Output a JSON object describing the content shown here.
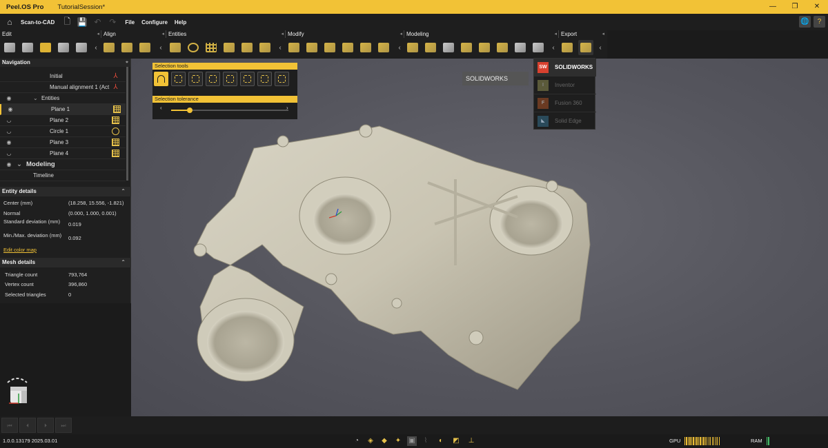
{
  "titlebar": {
    "app_name": "Peel.OS Pro",
    "session": "TutorialSession*",
    "minimize": "—",
    "restore": "❐",
    "close": "✕"
  },
  "menubar": {
    "mode": "Scan-to-CAD",
    "file": "File",
    "configure": "Configure",
    "help": "Help"
  },
  "toolbar_sections": {
    "edit": "Edit",
    "align": "Align",
    "entities": "Entities",
    "modify": "Modify",
    "modeling": "Modeling",
    "export": "Export"
  },
  "navigation": {
    "title": "Navigation",
    "rows": {
      "initial": "Initial",
      "manual": "Manual alignment 1 (Act",
      "entities": "Entities",
      "plane1": "Plane 1",
      "plane2": "Plane 2",
      "circle1": "Circle 1",
      "plane3": "Plane 3",
      "plane4": "Plane 4",
      "modeling": "Modeling",
      "timeline": "Timeline"
    }
  },
  "entity_details": {
    "title": "Entity details",
    "center_k": "Center (mm)",
    "center_v": "(18.258, 15.556, -1.821)",
    "normal_k": "Normal",
    "normal_v": "(0.000, 1.000, 0.001)",
    "std_k": "Standard deviation (mm)",
    "std_v": "0.019",
    "minmax_k": "Min./Max. deviation (mm)",
    "minmax_v": "0.092",
    "link": "Edit color map"
  },
  "mesh_details": {
    "title": "Mesh details",
    "tri_k": "Triangle count",
    "tri_v": "793,764",
    "vert_k": "Vertex count",
    "vert_v": "396,860",
    "sel_k": "Selected triangles",
    "sel_v": "0"
  },
  "selection_tools": {
    "title": "Selection tools",
    "tolerance_title": "Selection tolerance",
    "tolerance_value": 0.16
  },
  "export_menu": {
    "solidworks": "SOLIDWORKS",
    "inventor": "Inventor",
    "fusion": "Fusion 360",
    "solidedge": "Solid Edge"
  },
  "tooltip": {
    "text": "SOLIDWORKS"
  },
  "status": {
    "version": "1.0.0.13179 2025.03.01",
    "gpu": "GPU",
    "ram": "RAM"
  },
  "colors": {
    "accent": "#f2c236",
    "ram": "#46c06a"
  }
}
